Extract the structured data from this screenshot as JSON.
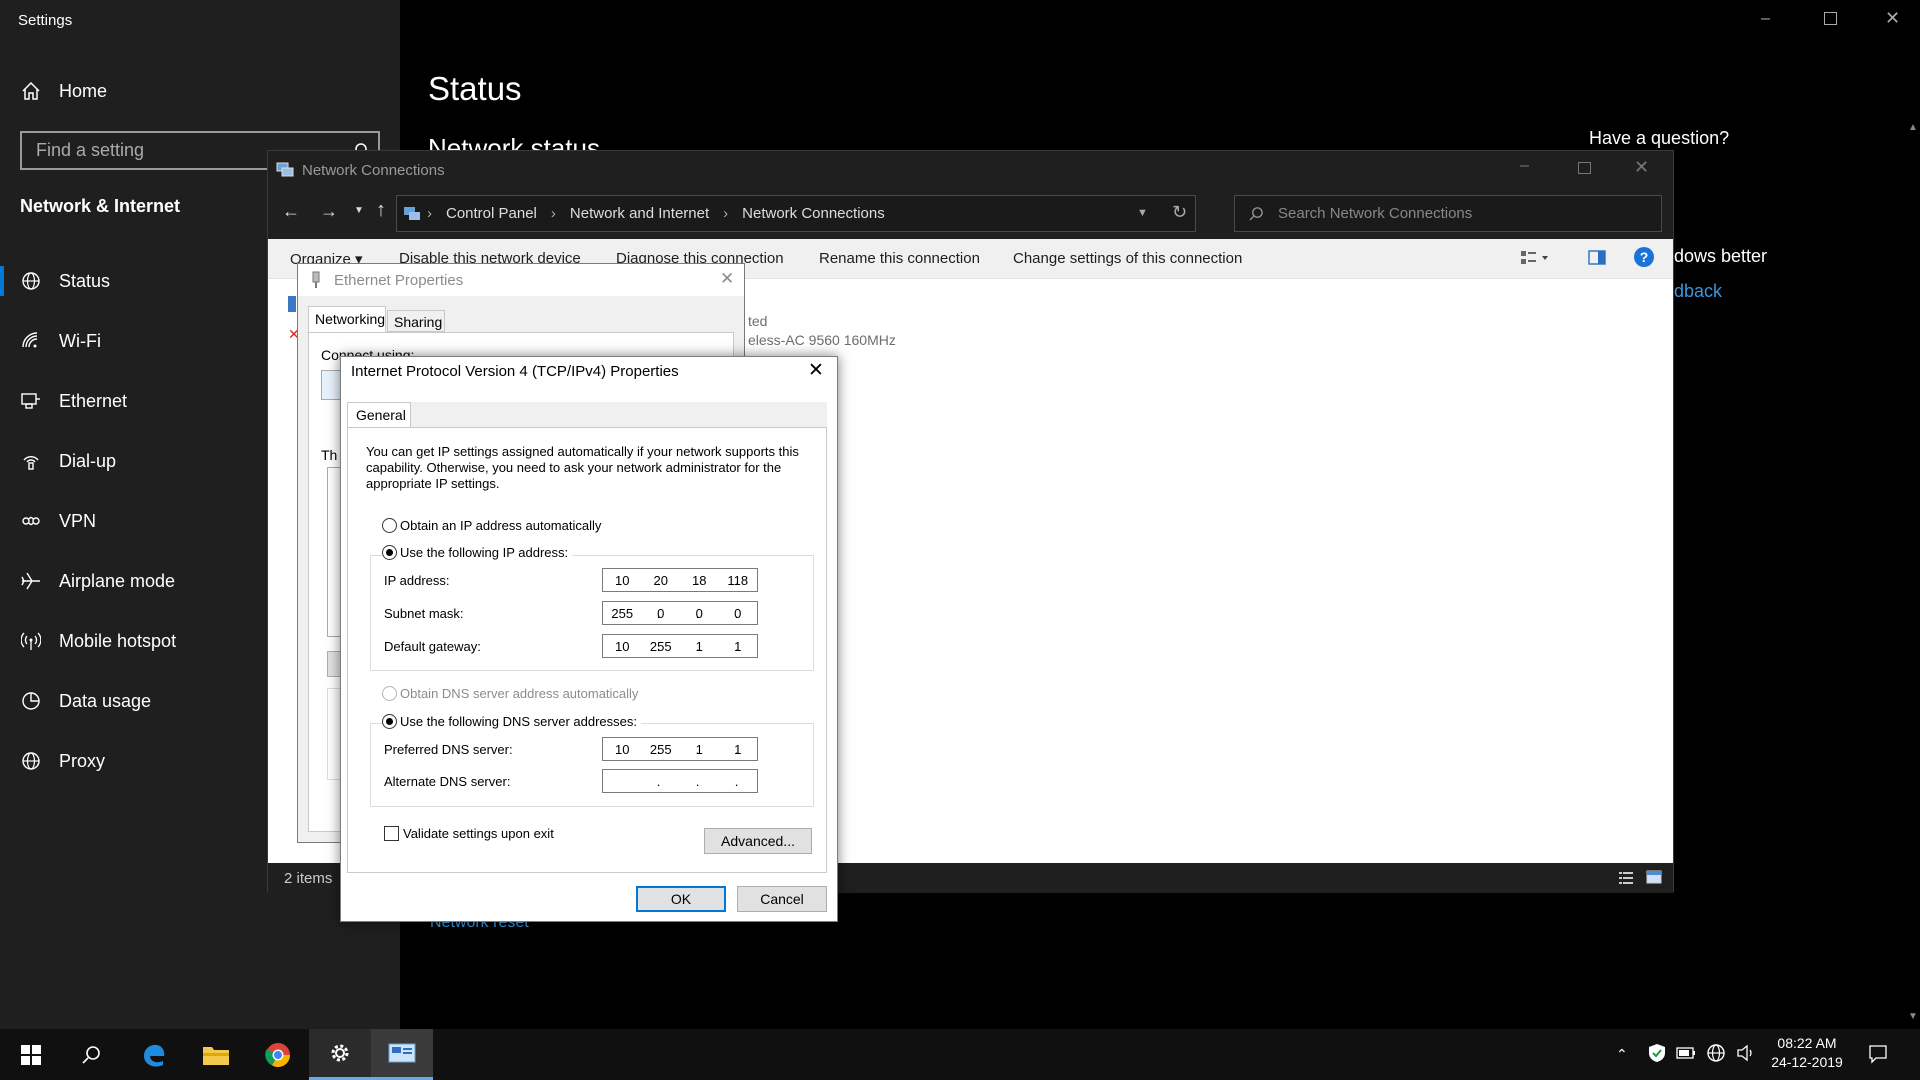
{
  "settings": {
    "title": "Settings",
    "home": "Home",
    "search_placeholder": "Find a setting",
    "section": "Network & Internet",
    "nav": [
      {
        "label": "Status",
        "icon": "globe-icon"
      },
      {
        "label": "Wi-Fi",
        "icon": "wifi-icon"
      },
      {
        "label": "Ethernet",
        "icon": "ethernet-icon"
      },
      {
        "label": "Dial-up",
        "icon": "dialup-icon"
      },
      {
        "label": "VPN",
        "icon": "vpn-icon"
      },
      {
        "label": "Airplane mode",
        "icon": "airplane-icon"
      },
      {
        "label": "Mobile hotspot",
        "icon": "hotspot-icon"
      },
      {
        "label": "Data usage",
        "icon": "data-usage-icon"
      },
      {
        "label": "Proxy",
        "icon": "globe-icon"
      }
    ],
    "page_title": "Status",
    "network_status": "Network status",
    "have_question": "Have a question?",
    "windows_better": "dows better",
    "feedback_link": "dback",
    "network_reset": "Network reset"
  },
  "explorer": {
    "title": "Network Connections",
    "breadcrumb": [
      "Control Panel",
      "Network and Internet",
      "Network Connections"
    ],
    "search_placeholder": "Search Network Connections",
    "commands": [
      "Organize ▾",
      "Disable this network device",
      "Diagnose this connection",
      "Rename this connection",
      "Change settings of this connection"
    ],
    "item_status": "ted",
    "item_adapter": "eless-AC 9560 160MHz",
    "status_count": "2 items"
  },
  "ethernet_dialog": {
    "title": "Ethernet Properties",
    "tabs": [
      "Networking",
      "Sharing"
    ],
    "connect_using": "Connect using:",
    "this_conn": "Th"
  },
  "ipv4_dialog": {
    "title": "Internet Protocol Version 4 (TCP/IPv4) Properties",
    "tab": "General",
    "description": "You can get IP settings assigned automatically if your network supports this capability. Otherwise, you need to ask your network administrator for the appropriate IP settings.",
    "obtain_ip_auto": "Obtain an IP address automatically",
    "use_following_ip": "Use the following IP address:",
    "ip_label": "IP address:",
    "ip": [
      "10",
      "20",
      "18",
      "118"
    ],
    "subnet_label": "Subnet mask:",
    "subnet": [
      "255",
      "0",
      "0",
      "0"
    ],
    "gateway_label": "Default gateway:",
    "gateway": [
      "10",
      "255",
      "1",
      "1"
    ],
    "obtain_dns_auto": "Obtain DNS server address automatically",
    "use_following_dns": "Use the following DNS server addresses:",
    "pref_dns_label": "Preferred DNS server:",
    "pref_dns": [
      "10",
      "255",
      "1",
      "1"
    ],
    "alt_dns_label": "Alternate DNS server:",
    "alt_dns": [
      "",
      "",
      "",
      ""
    ],
    "validate": "Validate settings upon exit",
    "advanced": "Advanced...",
    "ok": "OK",
    "cancel": "Cancel"
  },
  "taskbar": {
    "time": "08:22 AM",
    "date": "24-12-2019"
  },
  "colors": {
    "accent": "#0078d7",
    "sidebar_bg": "#1f1f1f",
    "link": "#3a96dd"
  }
}
